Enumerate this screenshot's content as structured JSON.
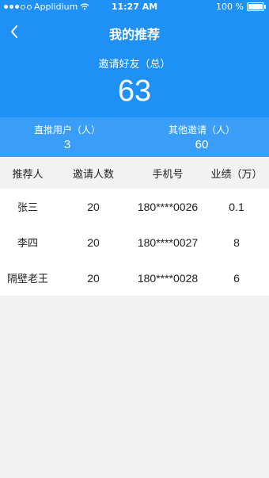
{
  "status_bar": {
    "carrier": "Applidium",
    "time": "11:27 AM",
    "battery": "100 %"
  },
  "header": {
    "title": "我的推荐",
    "total_label": "邀请好友（总）",
    "total_value": "63"
  },
  "stats": {
    "direct_label": "直推用户（人）",
    "direct_value": "3",
    "other_label": "其他邀请（人）",
    "other_value": "60"
  },
  "table": {
    "headers": [
      "推荐人",
      "邀请人数",
      "手机号",
      "业绩（万）"
    ],
    "rows": [
      {
        "referrer": "张三",
        "invites": "20",
        "phone": "180****0026",
        "performance": "0.1"
      },
      {
        "referrer": "李四",
        "invites": "20",
        "phone": "180****0027",
        "performance": "8"
      },
      {
        "referrer": "隔壁老王",
        "invites": "20",
        "phone": "180****0028",
        "performance": "6"
      }
    ]
  },
  "colors": {
    "primary": "#1e90f6",
    "stats_bg": "#3a9ef8",
    "page_bg": "#f2f2f2"
  },
  "icons": [
    "signal-dots-icon",
    "wifi-icon",
    "battery-icon",
    "back-arrow-icon"
  ]
}
